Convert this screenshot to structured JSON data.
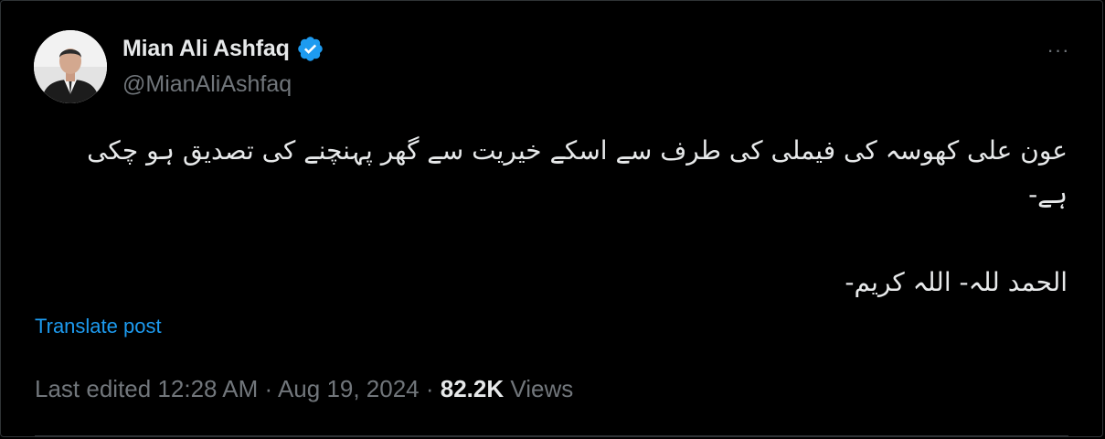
{
  "author": {
    "display_name": "Mian Ali Ashfaq",
    "handle": "@MianAliAshfaq",
    "verified_icon": "verified-badge-icon",
    "verified_color": "#1d9bf0"
  },
  "more_icon": "more-options-icon",
  "more_label": "···",
  "tweet": {
    "line1": "عون علی کھوسہ کی فیملی کی طرف سے اسکے خیریت سے گھر پہنچنے کی تصدیق ہو چکی ہے-",
    "line2": "الحمد للہ- اللہ کریم-"
  },
  "translate_label": "Translate post",
  "meta": {
    "edited_prefix": "Last edited 12:28 AM · Aug 19, 2024 · ",
    "views_count": "82.2K",
    "views_label": " Views"
  },
  "colors": {
    "background": "#000000",
    "text_primary": "#e7e9ea",
    "text_secondary": "#71767b",
    "link": "#1d9bf0",
    "border": "#2f3336"
  }
}
